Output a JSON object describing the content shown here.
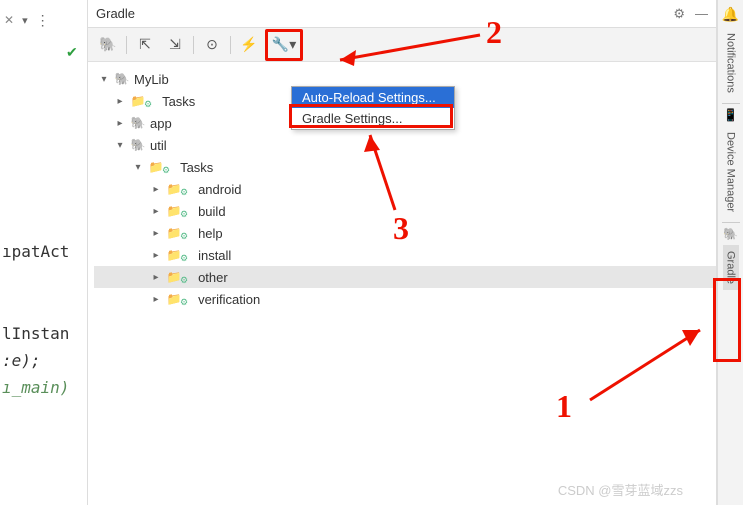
{
  "panel": {
    "title": "Gradle"
  },
  "toolbar": {
    "refresh": "⟳",
    "expand": "⤢",
    "collapse": "⤡",
    "analyze": "◯",
    "offline": "↯",
    "wrench": "🔧"
  },
  "tree": {
    "root": "MyLib",
    "nodes": [
      {
        "label": "Tasks",
        "depth": 1,
        "type": "folder",
        "collapsed": true
      },
      {
        "label": "app",
        "depth": 1,
        "type": "module",
        "collapsed": true
      },
      {
        "label": "util",
        "depth": 1,
        "type": "module",
        "collapsed": false
      },
      {
        "label": "Tasks",
        "depth": 2,
        "type": "folder",
        "collapsed": false
      },
      {
        "label": "android",
        "depth": 3,
        "type": "folder",
        "collapsed": true
      },
      {
        "label": "build",
        "depth": 3,
        "type": "folder",
        "collapsed": true
      },
      {
        "label": "help",
        "depth": 3,
        "type": "folder",
        "collapsed": true
      },
      {
        "label": "install",
        "depth": 3,
        "type": "folder",
        "collapsed": true
      },
      {
        "label": "other",
        "depth": 3,
        "type": "folder",
        "collapsed": true,
        "selected": true
      },
      {
        "label": "verification",
        "depth": 3,
        "type": "folder",
        "collapsed": true
      }
    ]
  },
  "menu": {
    "items": [
      {
        "label": "Auto-Reload Settings...",
        "highlighted": true
      },
      {
        "label": "Gradle Settings...",
        "highlighted": false
      }
    ]
  },
  "rail": {
    "notifications": "Notifications",
    "device_manager": "Device Manager",
    "gradle": "Gradle"
  },
  "editor": {
    "line1": "ıpatAct",
    "line2": "",
    "line3": "lInstan",
    "line4": ":e);",
    "line5": "ı_main)"
  },
  "annotations": {
    "n1": "1",
    "n2": "2",
    "n3": "3"
  },
  "watermark": "CSDN @雪芽蓝域zzs"
}
